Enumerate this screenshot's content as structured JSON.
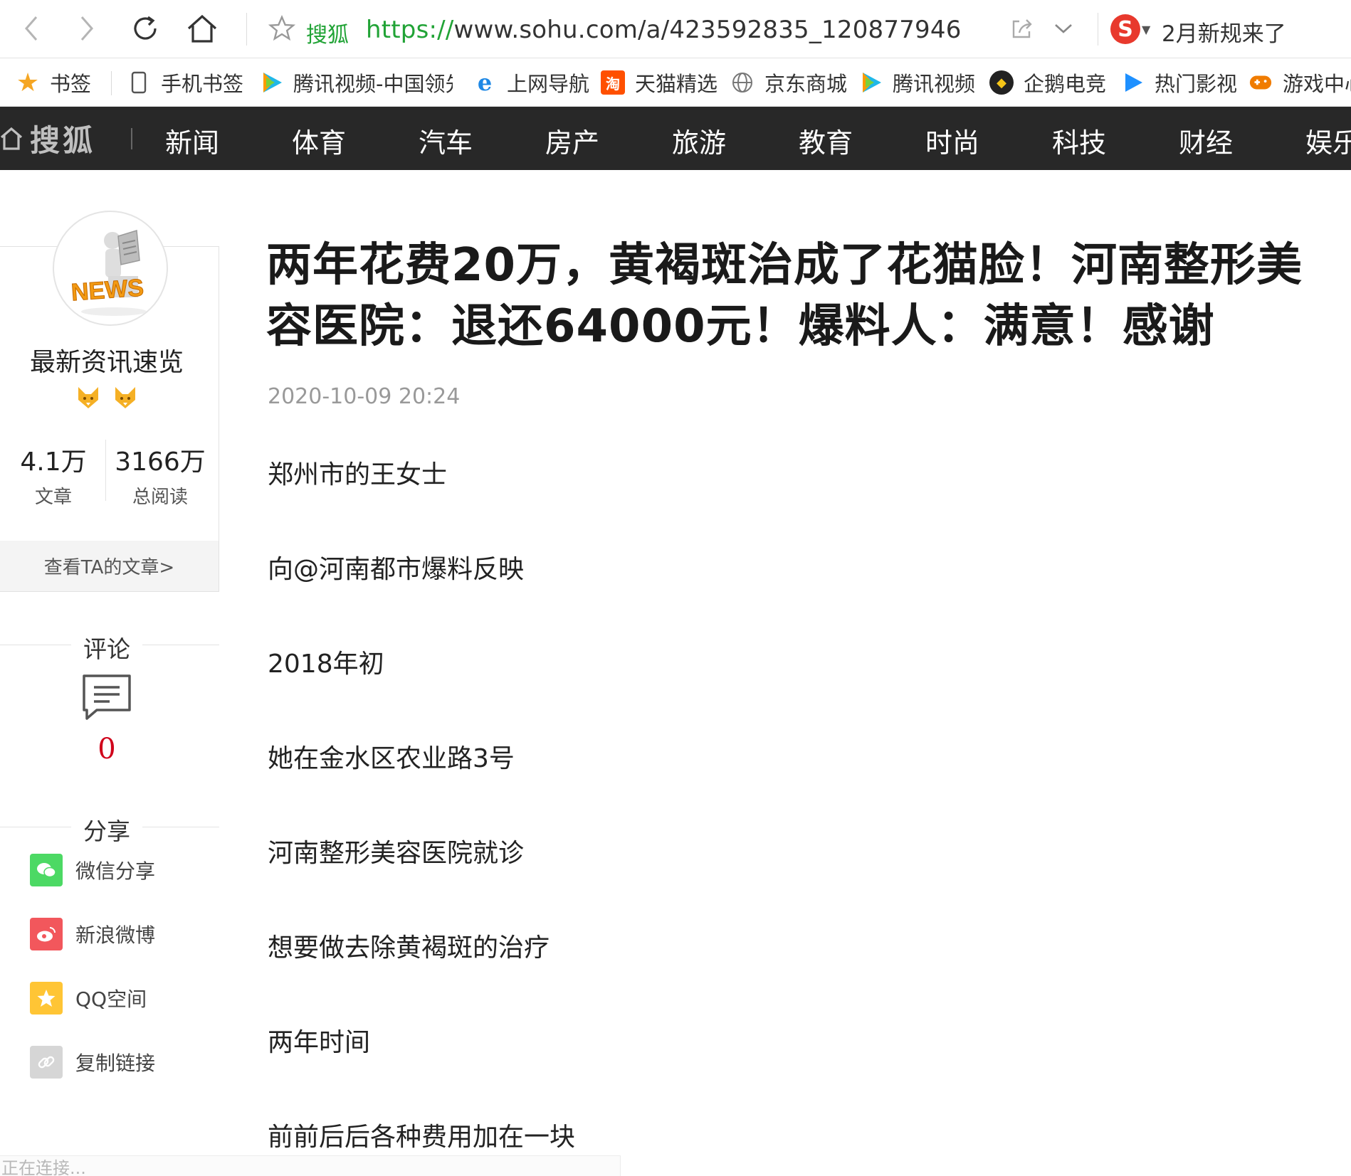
{
  "browser": {
    "site_name": "搜狐",
    "url_protocol": "https://",
    "url_rest": "www.sohu.com/a/423592835_120877946",
    "promo_text": "2月新规来了",
    "accent_green": "#21a336"
  },
  "bookmarks": [
    {
      "label": "书签",
      "icon": "star-icon"
    },
    {
      "label": "手机书签",
      "icon": "phone-icon"
    },
    {
      "label": "腾讯视频-中国领先",
      "icon": "tencent-video-icon"
    },
    {
      "label": "上网导航",
      "icon": "ie-icon"
    },
    {
      "label": "天猫精选",
      "icon": "taobao-icon"
    },
    {
      "label": "京东商城",
      "icon": "globe-icon"
    },
    {
      "label": "腾讯视频",
      "icon": "tencent-video-icon"
    },
    {
      "label": "企鹅电竞",
      "icon": "penguin-esports-icon"
    },
    {
      "label": "热门影视",
      "icon": "play-icon"
    },
    {
      "label": "游戏中心",
      "icon": "gamepad-icon"
    }
  ],
  "sitenav": {
    "logo_text": "搜狐",
    "items": [
      "新闻",
      "体育",
      "汽车",
      "房产",
      "旅游",
      "教育",
      "时尚",
      "科技",
      "财经",
      "娱乐"
    ]
  },
  "author": {
    "avatar_text": "NEWS",
    "name": "最新资讯速览",
    "articles_value": "4.1万",
    "articles_label": "文章",
    "reads_value": "3166万",
    "reads_label": "总阅读",
    "view_articles": "查看TA的文章>"
  },
  "comments": {
    "heading": "评论",
    "count": "0"
  },
  "share": {
    "heading": "分享",
    "items": [
      {
        "label": "微信分享",
        "color": "#4cd964",
        "icon": "wechat-icon"
      },
      {
        "label": "新浪微博",
        "color": "#f2575c",
        "icon": "weibo-icon"
      },
      {
        "label": "QQ空间",
        "color": "#ffc535",
        "icon": "qzone-icon"
      },
      {
        "label": "复制链接",
        "color": "#d6d6d6",
        "icon": "link-icon"
      }
    ]
  },
  "article": {
    "title": "两年花费20万，黄褐斑治成了花猫脸！河南整形美容医院：退还64000元！爆料人：满意！感谢",
    "date": "2020-10-09 20:24",
    "paragraphs": [
      "郑州市的王女士",
      "向@河南都市爆料反映",
      "2018年初",
      "她在金水区农业路3号",
      "河南整形美容医院就诊",
      "想要做去除黄褐斑的治疗",
      "两年时间",
      "前前后后各种费用加在一块"
    ]
  },
  "status": {
    "text": "正在连接..."
  }
}
